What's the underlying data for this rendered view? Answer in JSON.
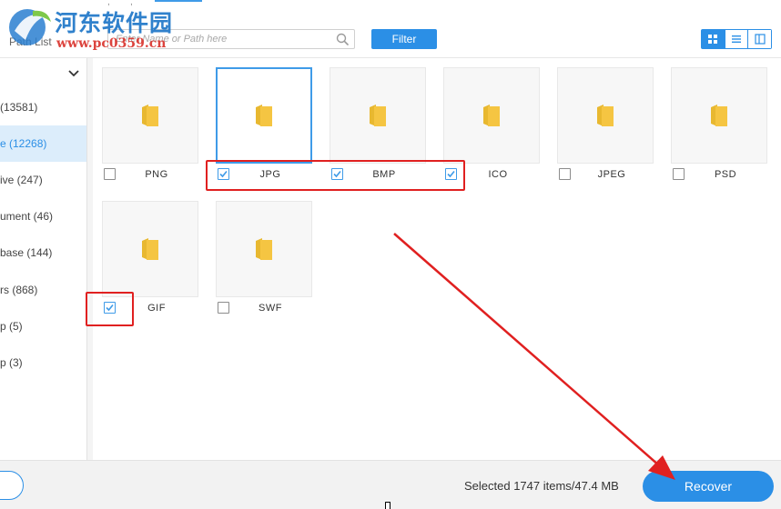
{
  "watermark": {
    "title": "河东软件园",
    "url": "www.pc0359.cn"
  },
  "toolbar": {
    "path_list_label": "Path List",
    "search_placeholder": "Enter Name or Path here",
    "search_value": "",
    "filter_label": "Filter",
    "view_modes": [
      "grid-view-icon",
      "list-view-icon",
      "detail-view-icon"
    ],
    "active_view": "grid"
  },
  "sidebar": {
    "items": [
      {
        "label": "(13581)",
        "active": false
      },
      {
        "label": "e (12268)",
        "active": true
      },
      {
        "label": "ive (247)",
        "active": false
      },
      {
        "label": "ument (46)",
        "active": false
      },
      {
        "label": "base (144)",
        "active": false
      },
      {
        "label": "rs (868)",
        "active": false
      },
      {
        "label": "p (5)",
        "active": false
      },
      {
        "label": "p (3)",
        "active": false
      }
    ]
  },
  "files": [
    {
      "label": "PNG",
      "checked": false,
      "selected": false
    },
    {
      "label": "JPG",
      "checked": true,
      "selected": true
    },
    {
      "label": "BMP",
      "checked": true,
      "selected": false
    },
    {
      "label": "ICO",
      "checked": true,
      "selected": false
    },
    {
      "label": "JPEG",
      "checked": false,
      "selected": false
    },
    {
      "label": "PSD",
      "checked": false,
      "selected": false
    },
    {
      "label": "GIF",
      "checked": true,
      "selected": false
    },
    {
      "label": "SWF",
      "checked": false,
      "selected": false
    }
  ],
  "footer": {
    "selected_text": "Selected 1747 items/47.4 MB",
    "recover_label": "Recover"
  },
  "colors": {
    "accent": "#2b8fe6",
    "annotation": "#e02020",
    "folder": "#f5c542"
  }
}
